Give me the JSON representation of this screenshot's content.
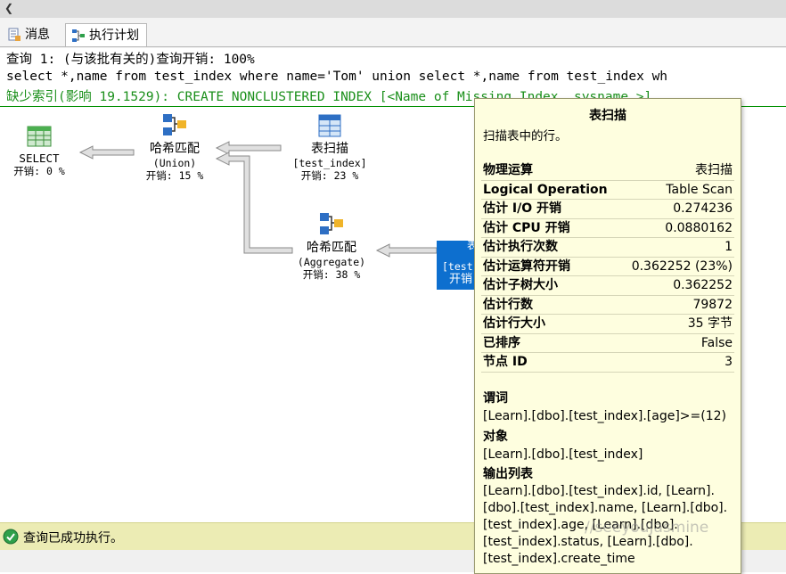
{
  "tabs": [
    {
      "label": "消息",
      "icon": "messages-icon"
    },
    {
      "label": "执行计划",
      "icon": "execution-plan-icon"
    }
  ],
  "query": {
    "header": "查询 1: (与该批有关的)查询开销: 100%",
    "sql": "select *,name from test_index where name='Tom' union select *,name from test_index wh",
    "missing_index": "缺少索引(影响 19.1529): CREATE NONCLUSTERED INDEX [<Name of Missing Index, sysname,>]"
  },
  "plan_nodes": {
    "select": {
      "label": "SELECT",
      "cost": "开销: 0 %"
    },
    "hash_union": {
      "label": "哈希匹配",
      "sub": "(Union)",
      "cost": "开销: 15 %"
    },
    "table_scan": {
      "label": "表扫描",
      "sub": "[test_index]",
      "cost": "开销: 23 %"
    },
    "hash_aggregate": {
      "label": "哈希匹配",
      "sub": "(Aggregate)",
      "cost": "开销: 38 %"
    },
    "selected_scan": {
      "label": "表",
      "sub": "[test",
      "cost": "开销"
    }
  },
  "tooltip": {
    "title": "表扫描",
    "description": "扫描表中的行。",
    "rows": [
      {
        "key": "物理运算",
        "value": "表扫描"
      },
      {
        "key": "Logical Operation",
        "value": "Table Scan"
      },
      {
        "key": "估计 I/O 开销",
        "value": "0.274236"
      },
      {
        "key": "估计 CPU 开销",
        "value": "0.0880162"
      },
      {
        "key": "估计执行次数",
        "value": "1"
      },
      {
        "key": "估计运算符开销",
        "value": "0.362252 (23%)"
      },
      {
        "key": "估计子树大小",
        "value": "0.362252"
      },
      {
        "key": "估计行数",
        "value": "79872"
      },
      {
        "key": "估计行大小",
        "value": "35 字节"
      },
      {
        "key": "已排序",
        "value": "False"
      },
      {
        "key": "节点 ID",
        "value": "3"
      }
    ],
    "predicate_label": "谓词",
    "predicate": "[Learn].[dbo].[test_index].[age]>=(12)",
    "object_label": "对象",
    "object": "[Learn].[dbo].[test_index]",
    "output_label": "输出列表",
    "output_lines": [
      "[Learn].[dbo].[test_index].id, [Learn].",
      "[dbo].[test_index].name, [Learn].[dbo].",
      "[test_index].age, [Learn].[dbo].",
      "[test_index].status, [Learn].[dbo].",
      "[test_index].create_time"
    ]
  },
  "status": {
    "text": "查询已成功执行。",
    "icon": "success-check-icon"
  },
  "watermark": "//seeyouJasmine",
  "colors": {
    "status_bg": "#ececb4",
    "tooltip_bg": "#fefedf",
    "selected_node": "#0d6fcf",
    "missing_index_text": "#1a8f1a"
  }
}
